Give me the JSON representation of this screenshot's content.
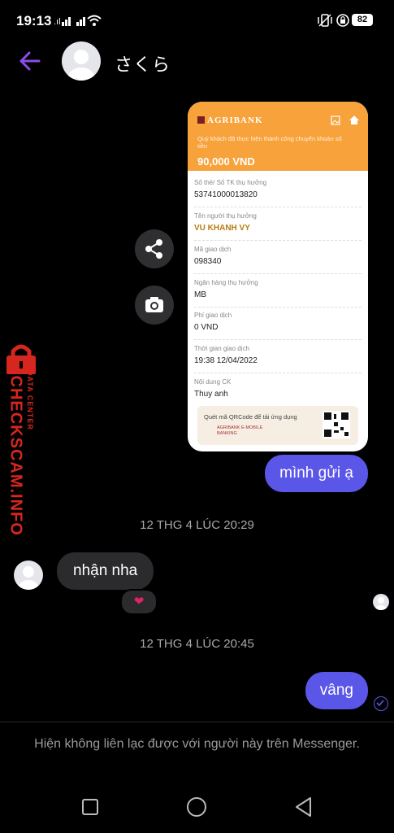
{
  "status_bar": {
    "time": "19:13",
    "battery": "82"
  },
  "header": {
    "contact_name": "さくら"
  },
  "receipt": {
    "brand": "AGRIBANK",
    "message": "Quý khách đã thực hiện thành công chuyển khoản số tiền",
    "amount": "90,000 VND",
    "rows": [
      {
        "label": "Số thẻ/ Số TK thụ hưởng",
        "value": "53741000013820"
      },
      {
        "label": "Tên người thụ hưởng",
        "value": "VU KHANH VY"
      },
      {
        "label": "Mã giao dịch",
        "value": "098340"
      },
      {
        "label": "Ngân hàng thụ hưởng",
        "value": "MB"
      },
      {
        "label": "Phí giao dịch",
        "value": "0 VND"
      },
      {
        "label": "Thời gian giao dịch",
        "value": "19:38 12/04/2022"
      },
      {
        "label": "Nội dung CK",
        "value": "Thuy anh"
      }
    ],
    "qr_text": "Quét mã QRCode để tải ứng dụng",
    "qr_app": "AGRIBANK E-MOBILE BANKING"
  },
  "messages": {
    "out_1": "mình gửi ạ",
    "ts_1": "12 THG 4 LÚC 20:29",
    "in_1": "nhận nha",
    "reaction": "❤",
    "ts_2": "12 THG 4 LÚC 20:45",
    "out_2": "vâng"
  },
  "notice": "Hiện không liên lạc được với người này trên Messenger.",
  "watermark": {
    "title": "CHECKSCAM.INFO",
    "subtitle": "DATA CENTER"
  },
  "colors": {
    "accent": "#5a56e8",
    "back_arrow": "#8a4de8",
    "receipt_header": "#f7a23b"
  }
}
